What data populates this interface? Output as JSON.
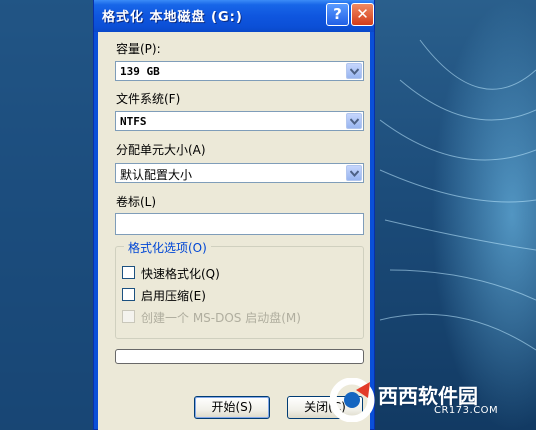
{
  "window": {
    "title": "格式化 本地磁盘 (G:)",
    "help_glyph": "?",
    "close_glyph": "✕"
  },
  "capacity": {
    "label": "容量(P):",
    "value": "139 GB"
  },
  "filesystem": {
    "label": "文件系统(F)",
    "value": "NTFS"
  },
  "allocation": {
    "label": "分配单元大小(A)",
    "value": "默认配置大小"
  },
  "volume": {
    "label": "卷标(L)",
    "value": ""
  },
  "format_options": {
    "title": "格式化选项(O)",
    "quick_format": {
      "label": "快速格式化(Q)",
      "checked": false
    },
    "compression": {
      "label": "启用压缩(E)",
      "checked": false
    },
    "msdos_boot": {
      "label": "创建一个 MS-DOS 启动盘(M)",
      "checked": false,
      "disabled": true
    }
  },
  "buttons": {
    "start": "开始(S)",
    "close": "关闭(C)"
  },
  "watermark": {
    "brand": "西西软件园",
    "url": "CR173.COM"
  },
  "colors": {
    "title_bar": "#0b4fd6",
    "client_bg": "#ece9d8",
    "group_title": "#0046d5"
  }
}
